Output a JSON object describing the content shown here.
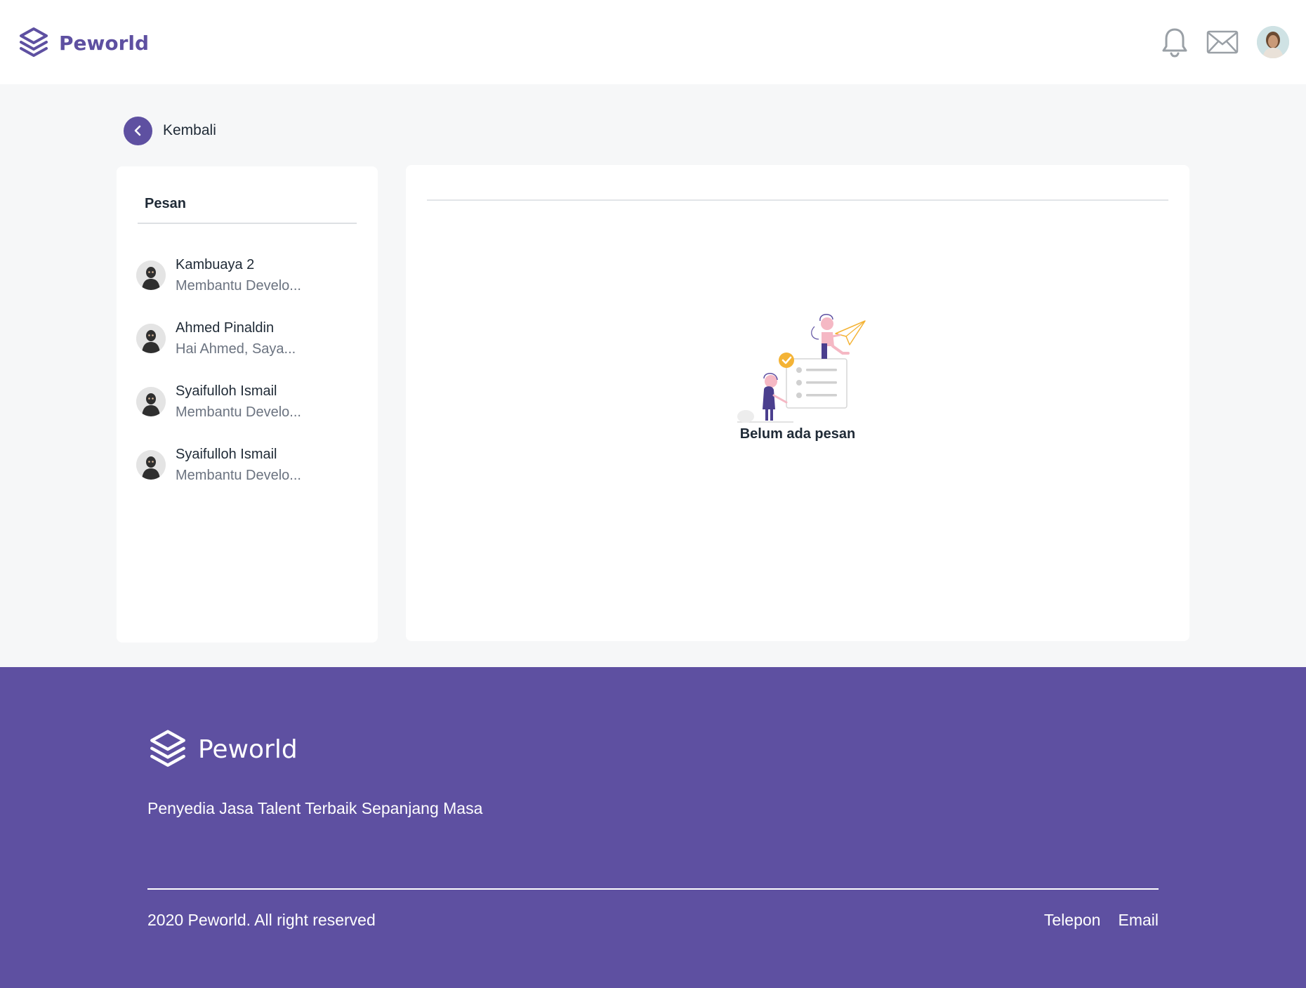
{
  "header": {
    "brand": "Peworld",
    "icons": [
      "logo-icon",
      "bell-icon",
      "mail-icon",
      "user-avatar"
    ]
  },
  "nav": {
    "back_label": "Kembali"
  },
  "messages_panel": {
    "title": "Pesan",
    "contacts": [
      {
        "name": "Kambuaya 2",
        "preview": "Membantu Develo..."
      },
      {
        "name": "Ahmed Pinaldin",
        "preview": "Hai Ahmed, Saya..."
      },
      {
        "name": "Syaifulloh Ismail",
        "preview": "Membantu Develo..."
      },
      {
        "name": "Syaifulloh Ismail",
        "preview": "Membantu Develo..."
      }
    ]
  },
  "chat_panel": {
    "empty_text": "Belum ada pesan"
  },
  "footer": {
    "brand": "Peworld",
    "tagline": "Penyedia Jasa Talent Terbaik Sepanjang Masa",
    "copyright": "2020 Peworld. All right reserved",
    "links": [
      "Telepon",
      "Email"
    ]
  },
  "colors": {
    "brand": "#5E50A1",
    "page_bg": "#F6F7F8",
    "panel_bg": "#FFFFFF",
    "text_dark": "#1F2A36",
    "text_muted": "#6B7380",
    "accent_orange": "#F4B335"
  }
}
